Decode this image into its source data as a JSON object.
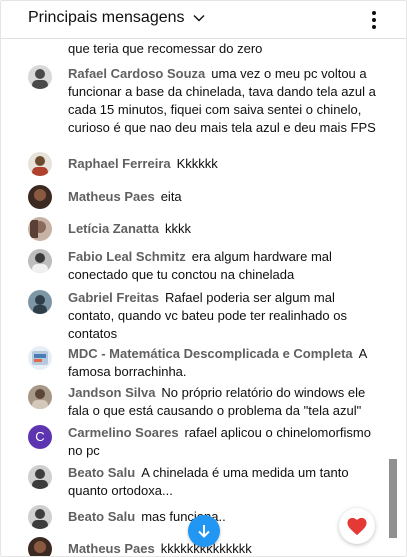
{
  "header": {
    "title": "Principais mensagens",
    "menu_icon": "more-vert-icon"
  },
  "messages": [
    {
      "author": "Rafael Cardoso Souza",
      "text": "uma vez o meu pc voltou a funcionar a base da chinelada, tava dando tela azul a cada 15 minutos, fiquei com saiva sentei o chinelo, curioso é que nao deu mais tela azul e deu mais FPS",
      "avatar_color": "#4a4a4a"
    },
    {
      "author": "Raphael Ferreira",
      "text": "Kkkkkk",
      "avatar_color": "#6b4a2e"
    },
    {
      "author": "Matheus Paes",
      "text": "eita",
      "avatar_color": "#5a3b2c"
    },
    {
      "author": "Letícia Zanatta",
      "text": "kkkk",
      "avatar_color": "#8a6a5a"
    },
    {
      "author": "Fabio Leal Schmitz",
      "text": "era algum hardware mal conectado que tu conctou na chinelada",
      "avatar_color": "#3a3a3a"
    },
    {
      "author": "Gabriel Freitas",
      "text": "Rafael poderia ser algum mal contato, quando vc bateu pode ter realinhado os contatos",
      "avatar_color": "#4b6a7a"
    },
    {
      "author": "MDC - Matemática Descomplicada e Completa",
      "text": "A famosa borrachinha.",
      "avatar_color": "#c9d7e6"
    },
    {
      "author": "Jandson Silva",
      "text": "No próprio relatório do windows ele fala o que está causando o problema da \"tela azul\"",
      "avatar_color": "#7a6a5a"
    },
    {
      "author": "Carmelino Soares",
      "text": "rafael aplicou o chinelomorfismo no pc",
      "avatar_letter": "C",
      "avatar_color": "#5e35b1"
    },
    {
      "author": "Beato Salu",
      "text": "A chinelada é uma medida um tanto quanto ortodoxa...",
      "avatar_color": "#3d3d3d"
    },
    {
      "author": "Beato Salu",
      "text": "mas funciona..",
      "avatar_color": "#3d3d3d"
    },
    {
      "author": "Matheus Paes",
      "text": "kkkkkkkkkkkkkk",
      "avatar_color": "#5a3b2c"
    }
  ],
  "fragment_text": "que teria que recomessar do zero",
  "controls": {
    "scroll_down_icon": "arrow-down-icon",
    "reaction_icon": "heart-icon",
    "accent_blue": "#2196f3",
    "heart_red": "#e53935"
  }
}
